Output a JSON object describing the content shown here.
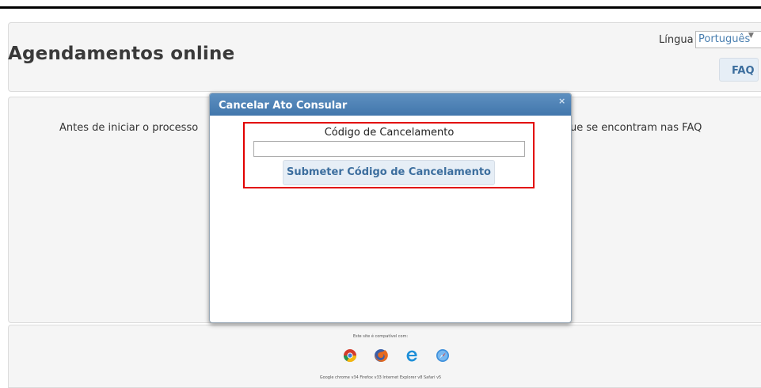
{
  "header": {
    "title": "Agendamentos online",
    "language_label": "Língua",
    "language_selected": "Português",
    "faq_label": "FAQ"
  },
  "content": {
    "intro_text_left": "Antes de iniciar o processo",
    "intro_text_right": "ue se encontram nas FAQ"
  },
  "modal": {
    "title": "Cancelar Ato Consular",
    "close_glyph": "×",
    "code_label": "Código de Cancelamento",
    "code_input_value": "",
    "submit_label": "Submeter Código de Cancelamento"
  },
  "footer": {
    "compat_text": "Este site é compatível com:",
    "browser_names": "Google chrome v34  Firefox v33  Internet Explorer v8  Safari v5",
    "browsers": [
      {
        "name": "chrome-icon"
      },
      {
        "name": "firefox-icon"
      },
      {
        "name": "internet-explorer-icon"
      },
      {
        "name": "safari-icon"
      }
    ]
  },
  "colors": {
    "accent": "#4277ac",
    "button_text": "#3c6e9e",
    "highlight": "#e20000"
  }
}
